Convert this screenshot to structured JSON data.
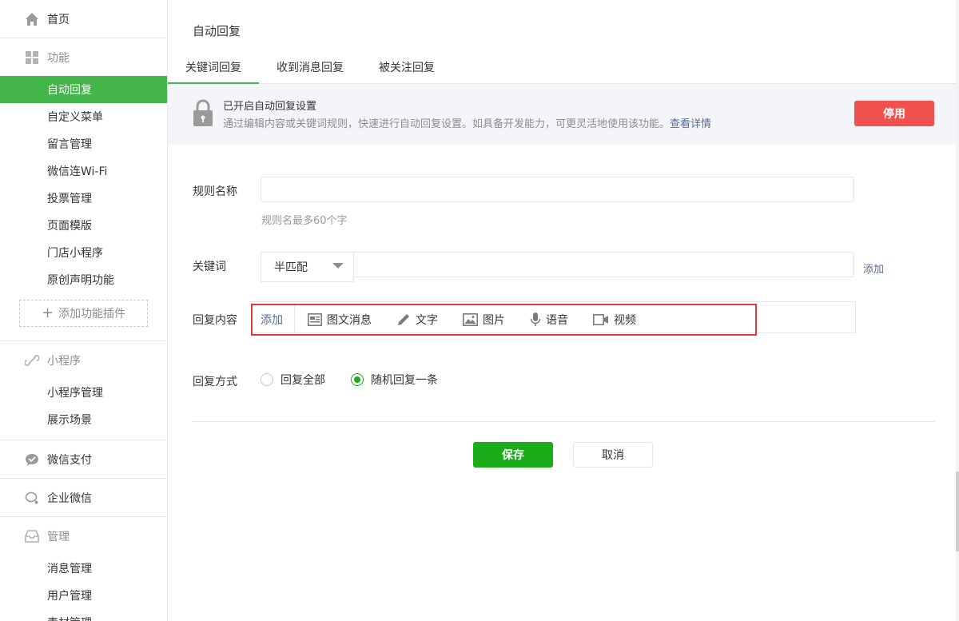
{
  "sidebar": {
    "home": {
      "label": "首页",
      "icon": "home-icon"
    },
    "features": {
      "label": "功能",
      "icon": "grid-icon",
      "items": [
        "自动回复",
        "自定义菜单",
        "留言管理",
        "微信连Wi-Fi",
        "投票管理",
        "页面模版",
        "门店小程序",
        "原创声明功能"
      ],
      "active_index": 0,
      "add_plugin_label": "添加功能插件"
    },
    "miniprogram": {
      "label": "小程序",
      "icon": "link-icon",
      "items": [
        "小程序管理",
        "展示场景"
      ]
    },
    "pay": {
      "label": "微信支付",
      "icon": "wechat-pay-icon"
    },
    "work": {
      "label": "企业微信",
      "icon": "work-wechat-icon"
    },
    "manage": {
      "label": "管理",
      "icon": "inbox-icon",
      "items": [
        "消息管理",
        "用户管理",
        "素材管理"
      ]
    }
  },
  "main": {
    "title": "自动回复",
    "tabs": [
      "关键词回复",
      "收到消息回复",
      "被关注回复"
    ],
    "active_tab": 0,
    "banner": {
      "title": "已开启自动回复设置",
      "desc": "通过编辑内容或关键词规则，快速进行自动回复设置。如具备开发能力，可更灵活地使用该功能。",
      "link": "查看详情",
      "button": "停用"
    },
    "form": {
      "rule_name_label": "规则名称",
      "rule_name_value": "",
      "rule_name_hint": "规则名最多60个字",
      "keyword_label": "关键词",
      "keyword_match": "半匹配",
      "keyword_value": "",
      "keyword_add": "添加",
      "reply_label": "回复内容",
      "reply_add": "添加",
      "reply_tools": [
        {
          "label": "图文消息",
          "icon": "news-icon"
        },
        {
          "label": "文字",
          "icon": "pencil-icon"
        },
        {
          "label": "图片",
          "icon": "image-icon"
        },
        {
          "label": "语音",
          "icon": "microphone-icon"
        },
        {
          "label": "视频",
          "icon": "video-icon"
        }
      ],
      "reply_mode_label": "回复方式",
      "reply_modes": [
        "回复全部",
        "随机回复一条"
      ],
      "reply_mode_selected": 1
    },
    "save_label": "保存",
    "cancel_label": "取消"
  },
  "colors": {
    "accent": "#44b549",
    "primary": "#1aad19",
    "danger": "#f0504e",
    "link": "#576b95",
    "highlight": "#e23c3c"
  }
}
